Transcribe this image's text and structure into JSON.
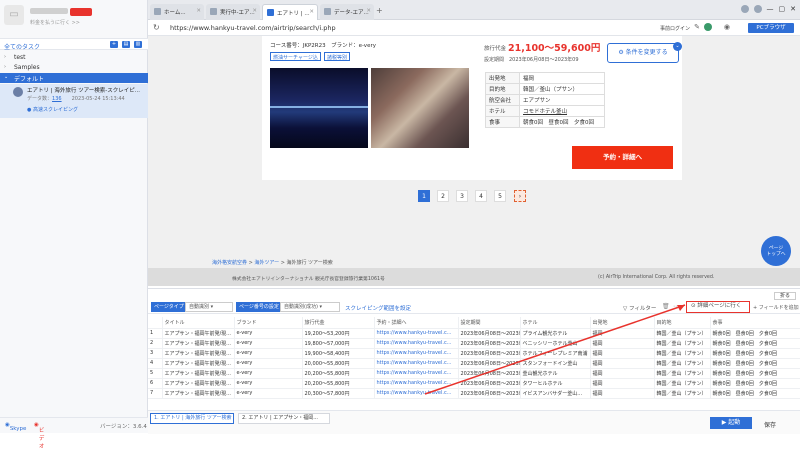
{
  "sidebar": {
    "logo_glyph": "▭",
    "user_sub": "料金を払うに行く >>",
    "all_tasks": "全てのタスク",
    "folders": [
      "test",
      "Samples",
      "デフォルト"
    ],
    "task": {
      "title": "エアトリ | 海外旅行 ツアー検索-スクレイピ...",
      "count_label": "データ数",
      "count": "136",
      "date": "2023-05-24 15:13:44",
      "cloud": "● 高速スクレイピング"
    },
    "footer": {
      "skype": "Skype",
      "video": "ビデオ",
      "version": "バージョン：3.6.4"
    }
  },
  "browser": {
    "tabs": [
      "ホーム...",
      "実行中-エア...",
      "エアトリ | ...",
      "データ-エア..."
    ],
    "url": "https://www.hankyu-travel.com/airtrip/search/i.php",
    "login": "事前ログイン",
    "pc_button": "PCブラウザ"
  },
  "page": {
    "course": "コース番号：JKP2R23　ブランド：e-very",
    "tags": [
      "燃油サーチャージ込",
      "諸税等別"
    ],
    "price_label": "旅行代金",
    "price": "21,100〜59,600円",
    "period": "設定期間　2023年06月08日〜2023年09",
    "condition_button": "条件を変更する",
    "info": [
      {
        "k": "出発地",
        "v": "福岡"
      },
      {
        "k": "目的地",
        "v": "韓国／釜山（プサン）"
      },
      {
        "k": "航空会社",
        "v": "エアプサン"
      },
      {
        "k": "ホテル",
        "v": "コモドホテル釜山"
      },
      {
        "k": "食事",
        "v": "朝食0回　昼食0回　夕食0回"
      }
    ],
    "reserve_button": "予約・詳細へ",
    "pagination": [
      "1",
      "2",
      "3",
      "4",
      "5",
      "›"
    ],
    "breadcrumb": {
      "a": "海外格安航空券",
      "b": "海外ツアー",
      "c": "> 海外旅行 ツアー検索"
    },
    "copyright_left": "株式会社エアトリインターナショナル 観光庁長官登録旅行業第1061号",
    "copyright_right": "(c) AirTrip International Corp. All rights reserved.",
    "page_top": "ページ\nトップへ"
  },
  "pane": {
    "page_type_label": "ページタイプ",
    "page_type": "自動識別",
    "page_number_label": "ページ番号の設定",
    "page_number": "自動識別(成功)",
    "scrape_range": "スクレイピング範囲を設定",
    "filter": "フィルター",
    "go_detail": "詳細ページに行く",
    "add_field": "+ フィールドを追加",
    "fold": "折る",
    "columns": [
      "",
      "タイトル",
      "ブランド",
      "旅行代金",
      "予約・詳細へ",
      "設定期間",
      "ホテル",
      "出発地",
      "目的地",
      "食事"
    ],
    "rows": [
      [
        "1",
        "エアプサン・福岡午前発/現...",
        "e-very",
        "19,200〜53,200円",
        "https://www.hankyu-travel.c...",
        "2023年06月08日〜2023年...",
        "プライム観光ホテル",
        "福岡",
        "韓国／釜山（プサン）",
        "朝食0回　昼食0回　夕食0回"
      ],
      [
        "2",
        "エアプサン・福岡午前発/現...",
        "e-very",
        "19,800〜57,000円",
        "https://www.hankyu-travel.c...",
        "2023年06月08日〜2023年...",
        "ベニッシリーホテル釜山",
        "福岡",
        "韓国／釜山（プサン）",
        "朝食0回　昼食0回　夕食0回"
      ],
      [
        "3",
        "エアプサン・福岡午前発/現...",
        "e-very",
        "19,900〜58,400円",
        "https://www.hankyu-travel.c...",
        "2023年06月08日〜2023年...",
        "ホテルフォーレプレミア南浦",
        "福岡",
        "韓国／釜山（プサン）",
        "朝食0回　昼食0回　夕食0回"
      ],
      [
        "4",
        "エアプサン・福岡午前発/現...",
        "e-very",
        "20,000〜55,800円",
        "https://www.hankyu-travel.c...",
        "2023年06月08日〜2023年...",
        "スタンフォードイン釜山",
        "福岡",
        "韓国／釜山（プサン）",
        "朝食0回　昼食0回　夕食0回"
      ],
      [
        "5",
        "エアプサン・福岡午前発/現...",
        "e-very",
        "20,200〜55,800円",
        "https://www.hankyu-travel.c...",
        "2023年06月08日〜2023年...",
        "釜山観光ホテル",
        "福岡",
        "韓国／釜山（プサン）",
        "朝食0回　昼食0回　夕食0回"
      ],
      [
        "6",
        "エアプサン・福岡午前発/現...",
        "e-very",
        "20,200〜55,800円",
        "https://www.hankyu-travel.c...",
        "2023年06月08日〜2023年...",
        "タワーヒルホテル",
        "福岡",
        "韓国／釜山（プサン）",
        "朝食0回　昼食0回　夕食0回"
      ],
      [
        "7",
        "エアプサン・福岡午前発/現...",
        "e-very",
        "20,300〜57,800円",
        "https://www.hankyu-travel.c...",
        "2023年06月08日〜2023年...",
        "イビスアンバサダー釜山...",
        "福岡",
        "韓国／釜山（プサン）",
        "朝食0回　昼食0回　夕食0回"
      ]
    ],
    "bottom_tabs": [
      "1. エアトリ | 海外旅行 ツアー検索",
      "2. エアトリ | エアプサン・福岡..."
    ],
    "start": "▶ 起動",
    "save": "保存"
  }
}
